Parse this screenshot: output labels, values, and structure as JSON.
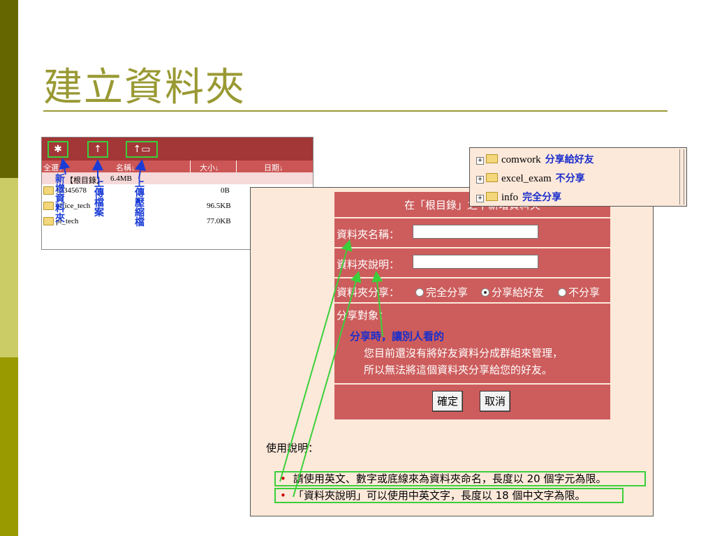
{
  "slide": {
    "title": "建立資料夾"
  },
  "file_manager": {
    "toolbar_icons": [
      "new-folder-icon",
      "upload-icon",
      "upload-archive-icon"
    ],
    "toolbar_glyphs": {
      "new_folder": "✱",
      "upload": "↑",
      "upload_archive": "↑▭"
    },
    "columns": {
      "select_all": "全選↓",
      "name": "名稱↓",
      "size": "大小↓",
      "date": "日期↓"
    },
    "root_row": {
      "name": "【根目錄】",
      "size": "6.4MB"
    },
    "rows": [
      {
        "name": "12345678",
        "size": "0B"
      },
      {
        "name": "office_tech",
        "size": "96.5KB"
      },
      {
        "name": "pi_tech",
        "size": "77.0KB"
      }
    ],
    "annotations": {
      "new_folder": "新增資料夾",
      "upload": "上傳檔案",
      "upload_archive": "上傳壓縮檔"
    }
  },
  "dialog": {
    "title": "在「根目錄」之下新增資料夾",
    "name_label": "資料夾名稱：",
    "desc_label": "資料夾說明：",
    "share_label": "資料夾分享：",
    "share_options": [
      "完全分享",
      "分享給好友",
      "不分享"
    ],
    "share_selected": "分享給好友",
    "target_label": "分享對象：",
    "hint": "分享時，讓別人看的",
    "message_line1": "您目前還沒有將好友資料分成群組來管理，",
    "message_line2": "所以無法將這個資料夾分享給您的好友。",
    "ok_button": "確定",
    "cancel_button": "取消",
    "usage_title": "使用說明：",
    "bullets": [
      "請使用英文、數字或底線來為資料夾命名，長度以 20 個字元為限。",
      "「資料夾說明」可以使用中英文字，長度以 18 個中文字為限。"
    ]
  },
  "share_popup": {
    "items": [
      {
        "name": "comwork",
        "tag": "分享給好友"
      },
      {
        "name": "excel_exam",
        "tag": "不分享"
      },
      {
        "name": "info",
        "tag": "完全分享"
      }
    ]
  },
  "colors": {
    "accent": "#999933",
    "panel_red": "#cd5c5c",
    "highlight_green": "#3ad03a",
    "hint_blue": "#1a2ecc"
  }
}
